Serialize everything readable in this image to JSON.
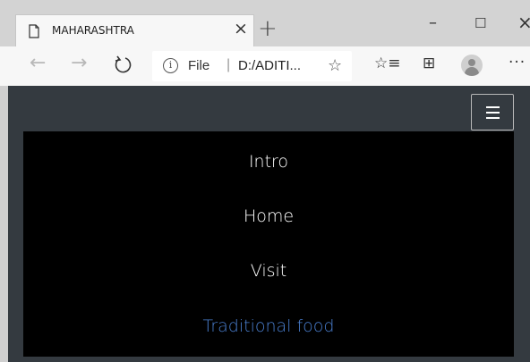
{
  "tab": {
    "title": "MAHARASHTRA",
    "close_glyph": "×",
    "page_icon": "page-icon"
  },
  "tabstrip": {
    "new_tab_glyph": "+"
  },
  "window_controls": {
    "minimize": "–",
    "maximize": "☐",
    "close": "×"
  },
  "navigation": {
    "back_glyph": "←",
    "forward_glyph": "→",
    "refresh_icon": "refresh-icon"
  },
  "address_bar": {
    "scheme_label": "File",
    "separator": "|",
    "url": "D:/ADITI..."
  },
  "toolbar": {
    "star_add_glyph": "☆",
    "favorites_glyph": "☆≡",
    "collections_glyph": "⊞",
    "more_glyph": "···"
  },
  "site": {
    "menu_toggle_icon": "hamburger-icon",
    "menu": [
      {
        "label": "Intro",
        "active": false
      },
      {
        "label": "Home",
        "active": false
      },
      {
        "label": "Visit",
        "active": false
      },
      {
        "label": "Traditional food",
        "active": true
      }
    ]
  },
  "colors": {
    "page_bg": "#343a40",
    "menu_bg": "#000000",
    "active_link": "#4a7fd0",
    "menu_text": "#ffffff"
  }
}
